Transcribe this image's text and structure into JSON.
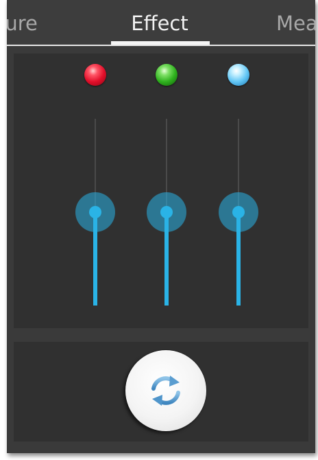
{
  "tabs": {
    "left_label": "ture",
    "active_label": "Effect",
    "right_label": "Mea"
  },
  "channels": [
    {
      "name": "red",
      "led_color": "#e20f2a",
      "level_percent": 50
    },
    {
      "name": "green",
      "led_color": "#2fb21e",
      "level_percent": 50
    },
    {
      "name": "blue",
      "led_color": "#62c6f5",
      "level_percent": 50
    }
  ],
  "colors": {
    "accent": "#2ab3e6",
    "background": "#3a3a3a",
    "panel": "#303030"
  },
  "reset_button": {
    "icon": "refresh-icon"
  }
}
